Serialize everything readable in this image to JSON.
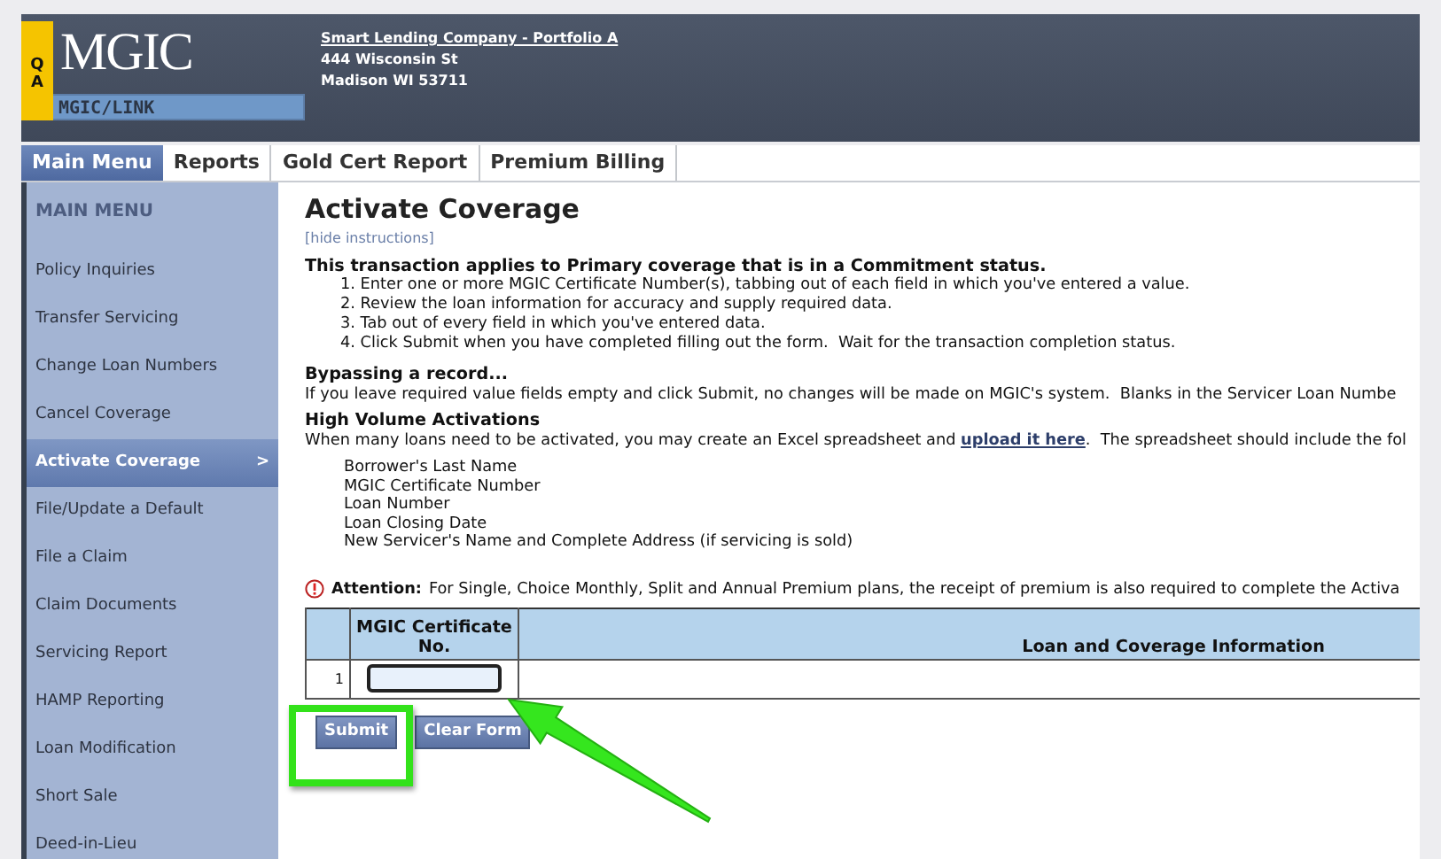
{
  "header": {
    "logo": {
      "badge_letters": [
        "Q",
        "A"
      ],
      "name": "MGIC",
      "product": "MGIC/LINK"
    },
    "company": {
      "name": "Smart Lending Company - Portfolio A",
      "address_lines": [
        "444 Wisconsin St",
        "Madison WI 53711"
      ]
    }
  },
  "tabs": [
    {
      "label": "Main Menu",
      "selected": true
    },
    {
      "label": "Reports",
      "selected": false
    },
    {
      "label": "Gold Cert Report",
      "selected": false
    },
    {
      "label": "Premium Billing",
      "selected": false
    }
  ],
  "sidebar": {
    "heading": "MAIN MENU",
    "selected_marker": ">",
    "items": [
      {
        "label": "Policy Inquiries",
        "selected": false
      },
      {
        "label": "Transfer Servicing",
        "selected": false
      },
      {
        "label": "Change Loan Numbers",
        "selected": false
      },
      {
        "label": "Cancel Coverage",
        "selected": false
      },
      {
        "label": "Activate Coverage",
        "selected": true
      },
      {
        "label": "File/Update a Default",
        "selected": false
      },
      {
        "label": "File a Claim",
        "selected": false
      },
      {
        "label": "Claim Documents",
        "selected": false
      },
      {
        "label": "Servicing Report",
        "selected": false
      },
      {
        "label": "HAMP Reporting",
        "selected": false
      },
      {
        "label": "Loan Modification",
        "selected": false
      },
      {
        "label": "Short Sale",
        "selected": false
      },
      {
        "label": "Deed-in-Lieu",
        "selected": false
      }
    ]
  },
  "content": {
    "title": "Activate Coverage",
    "hide_link": "[hide instructions]",
    "intro": {
      "heading": "This transaction applies to Primary coverage that is in a Commitment status.",
      "steps": [
        "1. Enter one or more MGIC Certificate Number(s), tabbing out of each field in which you've entered a value.",
        "2. Review the loan information for accuracy and supply required data.",
        "3. Tab out of every field in which you've entered data.",
        "4. Click Submit when you have completed filling out the form.  Wait for the transaction completion status."
      ]
    },
    "bypass": {
      "heading": "Bypassing a record...",
      "text": "If you leave required value fields empty and click Submit, no changes will be made on MGIC's system.  Blanks in the Servicer Loan Numbe"
    },
    "high_volume": {
      "heading": "High Volume Activations",
      "text_before": "When many loans need to be activated, you may create an Excel spreadsheet and ",
      "link": "upload it here",
      "text_after": ".  The spreadsheet should include the fol",
      "fields": [
        "Borrower's Last Name",
        "MGIC Certificate Number",
        "Loan Number",
        "Loan Closing Date",
        "New Servicer's Name and Complete Address (if servicing is sold)"
      ]
    },
    "attention": {
      "label": "Attention:",
      "text": "For Single, Choice Monthly, Split and Annual Premium plans, the receipt of premium is also required to complete the Activa"
    },
    "table": {
      "columns": [
        "MGIC Certificate No.",
        "Loan and Coverage Information"
      ],
      "rows": [
        {
          "number": "1"
        }
      ]
    },
    "buttons": [
      {
        "label": "Submit"
      },
      {
        "label": "Clear Form"
      }
    ],
    "annotations": {
      "highlight_box": true,
      "arrow": true
    }
  }
}
